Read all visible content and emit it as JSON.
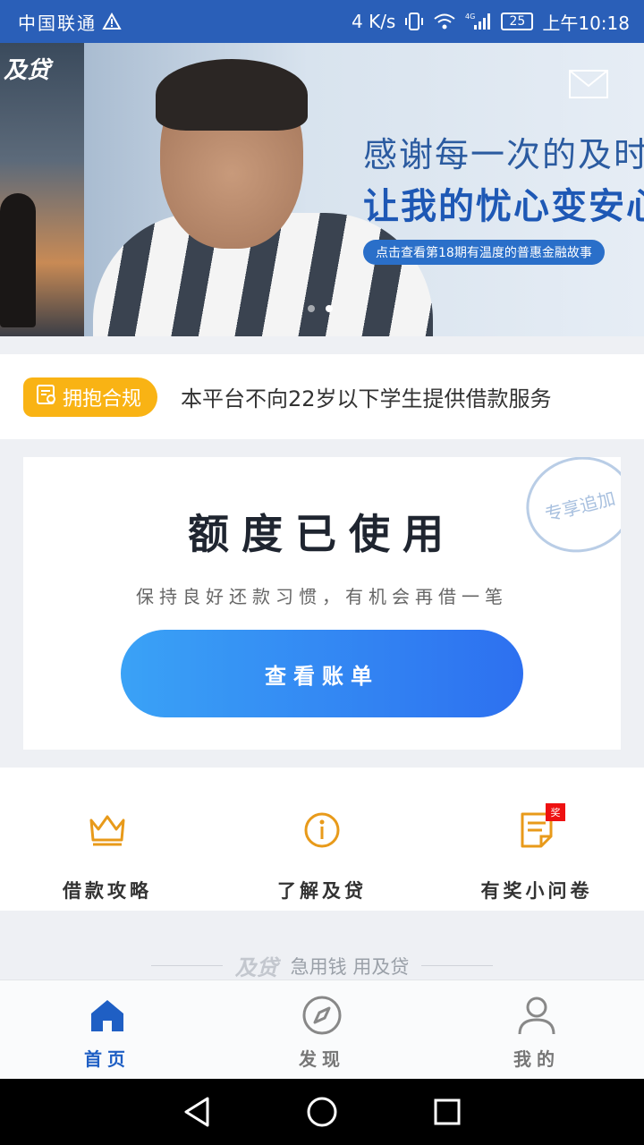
{
  "status_bar": {
    "carrier": "中国联通",
    "net_speed": "4 K/s",
    "network": "4G",
    "battery": "25",
    "time": "上午10:18"
  },
  "banner": {
    "side_logo": "及贷",
    "headline": "感谢每一次的及时",
    "subheadline": "让我的忧心变安心",
    "pill_text": "点击查看第18期有温度的普惠金融故事",
    "slide_count": 2,
    "active_slide": 2
  },
  "notice": {
    "badge_label": "拥抱合规",
    "text": "本平台不向22岁以下学生提供借款服务"
  },
  "credit_card": {
    "stamp_text": "专享追加",
    "title": "额度已使用",
    "subtitle": "保持良好还款习惯，有机会再借一笔",
    "button_label": "查看账单"
  },
  "quick_actions": [
    {
      "label": "借款攻略",
      "icon": "crown-icon"
    },
    {
      "label": "了解及贷",
      "icon": "info-icon"
    },
    {
      "label": "有奖小问卷",
      "icon": "survey-icon",
      "badge": "奖"
    }
  ],
  "slogan": {
    "logo": "及贷",
    "text": "急用钱 用及贷"
  },
  "bottom_nav": [
    {
      "label": "首页",
      "icon": "home-icon",
      "active": true
    },
    {
      "label": "发现",
      "icon": "compass-icon",
      "active": false
    },
    {
      "label": "我的",
      "icon": "profile-icon",
      "active": false
    }
  ],
  "colors": {
    "status_bar": "#2a5fb8",
    "accent_blue": "#2d70f0",
    "accent_yellow": "#f9b314",
    "icon_orange": "#e89a1a",
    "nav_active": "#1f5fc4"
  }
}
